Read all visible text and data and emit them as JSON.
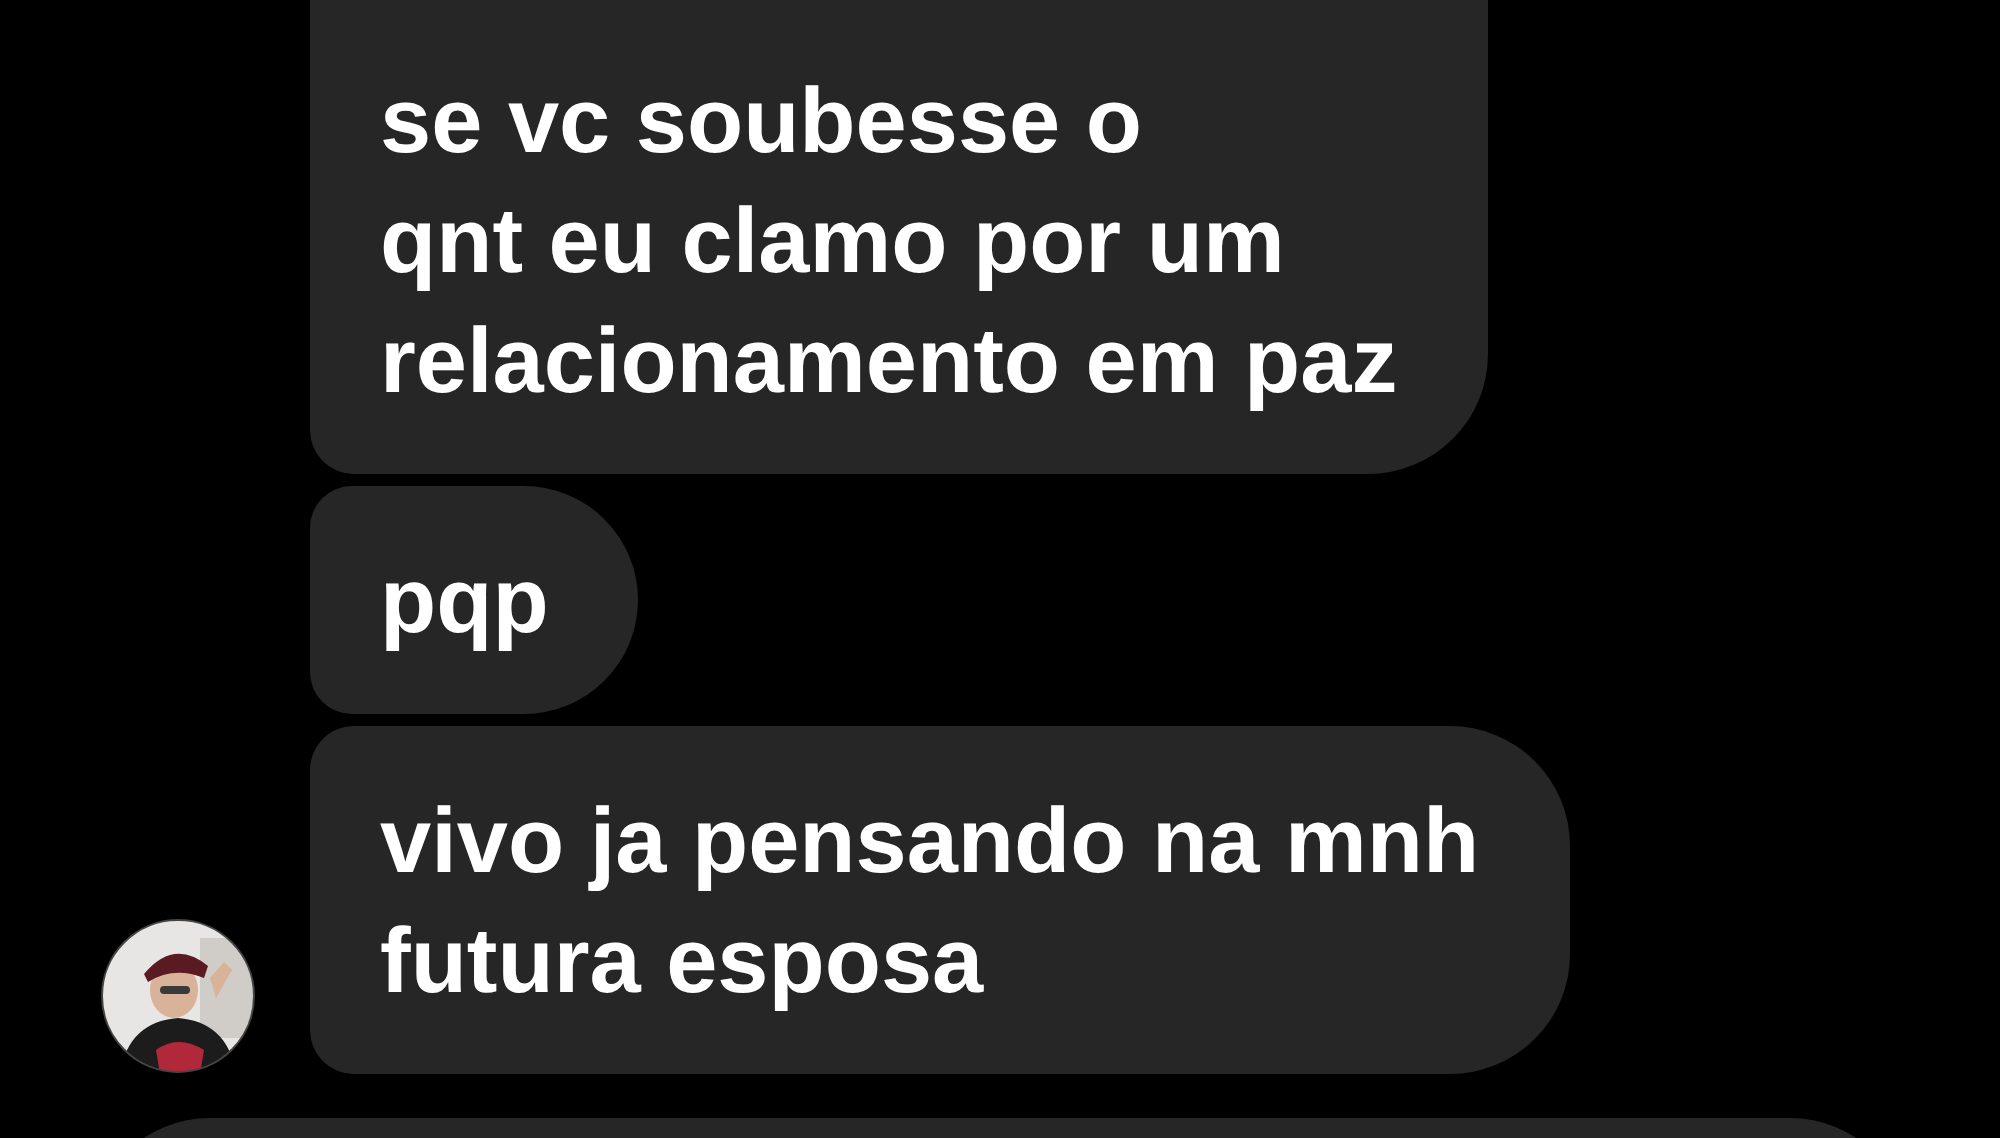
{
  "messages": [
    {
      "kind": "text",
      "text": "se vc soubesse o\nqnt eu clamo por um\nrelacionamento em paz",
      "avatar": false
    },
    {
      "kind": "text",
      "text": "pqp",
      "avatar": false
    },
    {
      "kind": "text",
      "text": "vivo ja pensando na mnh\nfutura esposa",
      "avatar": true
    },
    {
      "kind": "partial"
    }
  ]
}
